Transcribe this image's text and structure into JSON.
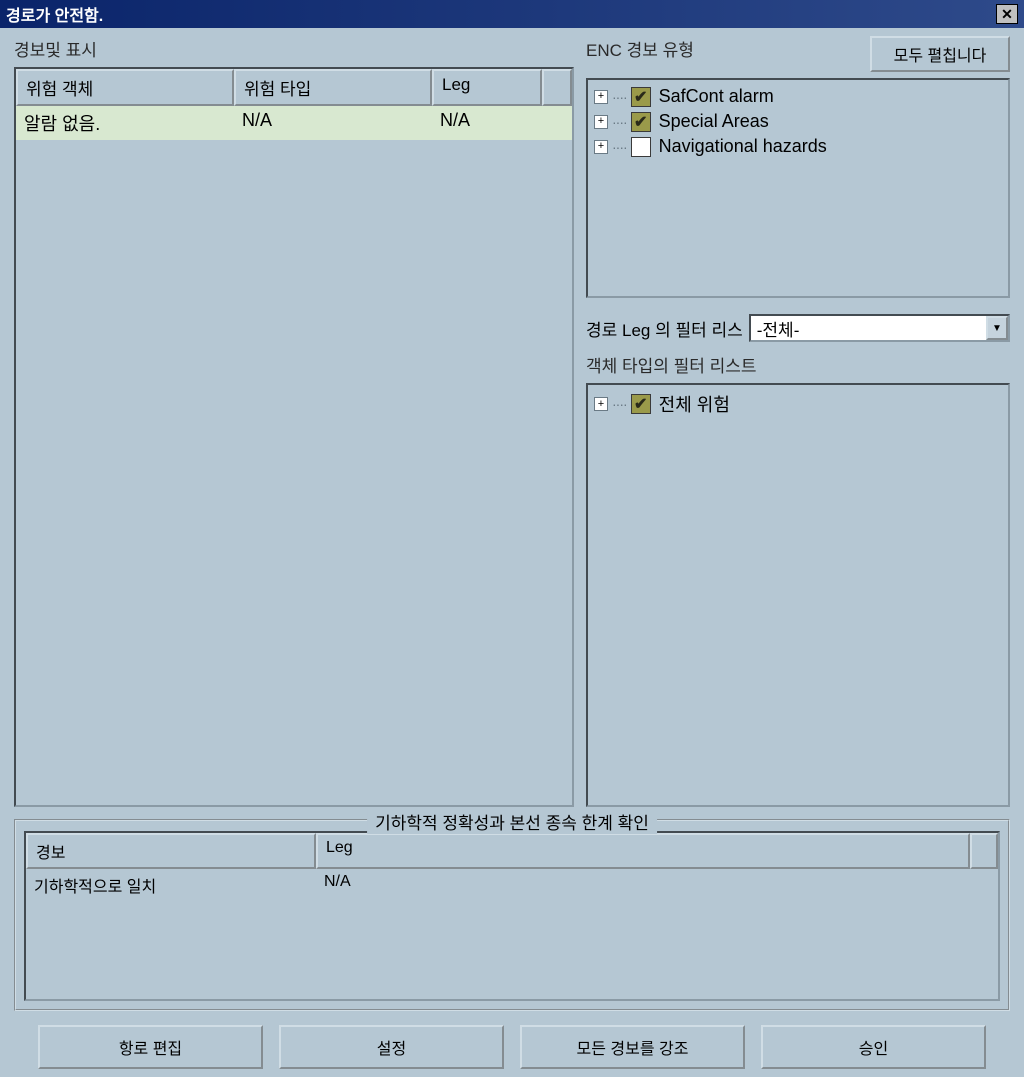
{
  "titlebar": {
    "title": "경로가 안전함."
  },
  "left": {
    "label": "경보및 표시",
    "table": {
      "headers": [
        "위험 객체",
        "위험 타입",
        "Leg"
      ],
      "row": [
        "알람 없음.",
        "N/A",
        "N/A"
      ]
    }
  },
  "right": {
    "enc_label": "ENC 경보 유형",
    "expand_all_btn": "모두 펼칩니다",
    "enc_tree": [
      {
        "label": "SafCont alarm",
        "checked": true
      },
      {
        "label": "Special Areas",
        "checked": true
      },
      {
        "label": "Navigational hazards",
        "checked": false
      }
    ],
    "leg_filter_label": "경로 Leg 의 필터 리스",
    "leg_filter_value": "-전체-",
    "obj_filter_label": "객체 타입의 필터 리스트",
    "obj_tree": [
      {
        "label": "전체 위험",
        "checked": true
      }
    ]
  },
  "geo": {
    "legend": "기하학적 정확성과 본선 종속 한계 확인",
    "headers": [
      "경보",
      "Leg"
    ],
    "row": [
      "기하학적으로 일치",
      "N/A"
    ]
  },
  "buttons": {
    "route_edit": "항로 편집",
    "settings": "설정",
    "highlight_all": "모든 경보를 강조",
    "ok": "승인"
  }
}
